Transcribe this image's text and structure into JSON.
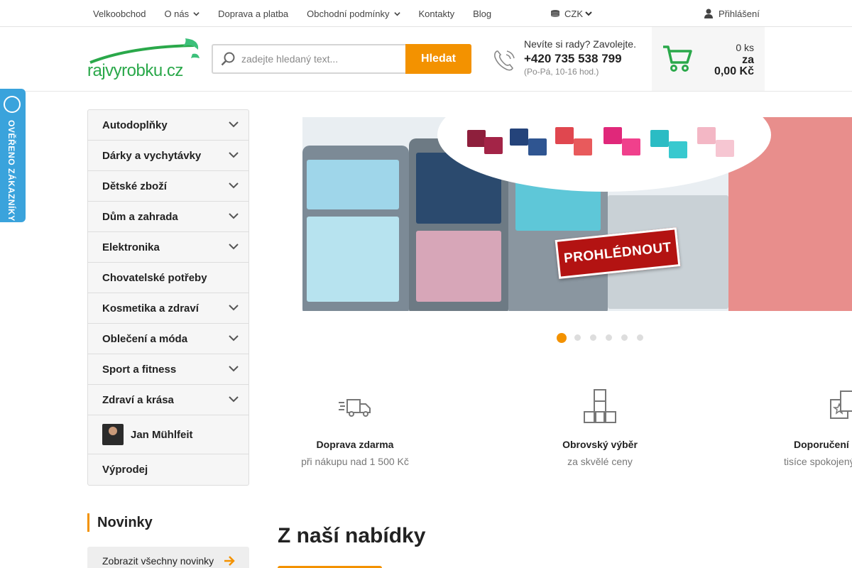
{
  "topnav": {
    "items": [
      {
        "label": "Velkoobchod",
        "dropdown": false
      },
      {
        "label": "O nás",
        "dropdown": true
      },
      {
        "label": "Doprava a platba",
        "dropdown": false
      },
      {
        "label": "Obchodní podmínky",
        "dropdown": true
      },
      {
        "label": "Kontakty",
        "dropdown": false
      },
      {
        "label": "Blog",
        "dropdown": false
      }
    ],
    "currency": "CZK",
    "login": "Přihlášení"
  },
  "header": {
    "logo_text": "rajvyrobku.cz",
    "search_placeholder": "zadejte hledaný text...",
    "search_button": "Hledat",
    "contact_line1": "Nevíte si rady? Zavolejte.",
    "contact_phone": "+420 735 538 799",
    "contact_hours": "(Po-Pá, 10-16 hod.)",
    "cart_qty": "0 ks",
    "cart_price_prefix": "za",
    "cart_price": "0,00 Kč"
  },
  "badge": {
    "text": "OVĚŘENO ZÁKAZNÍKY"
  },
  "categories": [
    {
      "label": "Autodoplňky",
      "expandable": true
    },
    {
      "label": "Dárky a vychytávky",
      "expandable": true
    },
    {
      "label": "Dětské zboží",
      "expandable": true
    },
    {
      "label": "Dům a zahrada",
      "expandable": true
    },
    {
      "label": "Elektronika",
      "expandable": true
    },
    {
      "label": "Chovatelské potřeby",
      "expandable": false
    },
    {
      "label": "Kosmetika a zdraví",
      "expandable": true
    },
    {
      "label": "Oblečení a móda",
      "expandable": true
    },
    {
      "label": "Sport a fitness",
      "expandable": true
    },
    {
      "label": "Zdraví a krása",
      "expandable": true
    },
    {
      "label": "Jan Mühlfeit",
      "expandable": false
    },
    {
      "label": "Výprodej",
      "expandable": false
    }
  ],
  "banner": {
    "cta": "PROHLÉDNOUT",
    "slides": 6,
    "active_slide": 1
  },
  "benefits": [
    {
      "icon": "delivery-truck-icon",
      "title": "Doprava zdarma",
      "subtitle": "při nákupu nad 1 500 Kč"
    },
    {
      "icon": "boxes-icon",
      "title": "Obrovský výběr",
      "subtitle": "za skvělé ceny"
    },
    {
      "icon": "recommended-box-icon",
      "title": "Doporučení z",
      "subtitle": "tisíce spokojený"
    }
  ],
  "novinky": {
    "title": "Novinky",
    "show_all": "Zobrazit všechny novinky"
  },
  "offer": {
    "title": "Z naší nabídky"
  },
  "colors": {
    "accent": "#f39200",
    "brand_green": "#2aa84a",
    "badge_blue": "#3aa3dc",
    "cta_red": "#b31312"
  }
}
